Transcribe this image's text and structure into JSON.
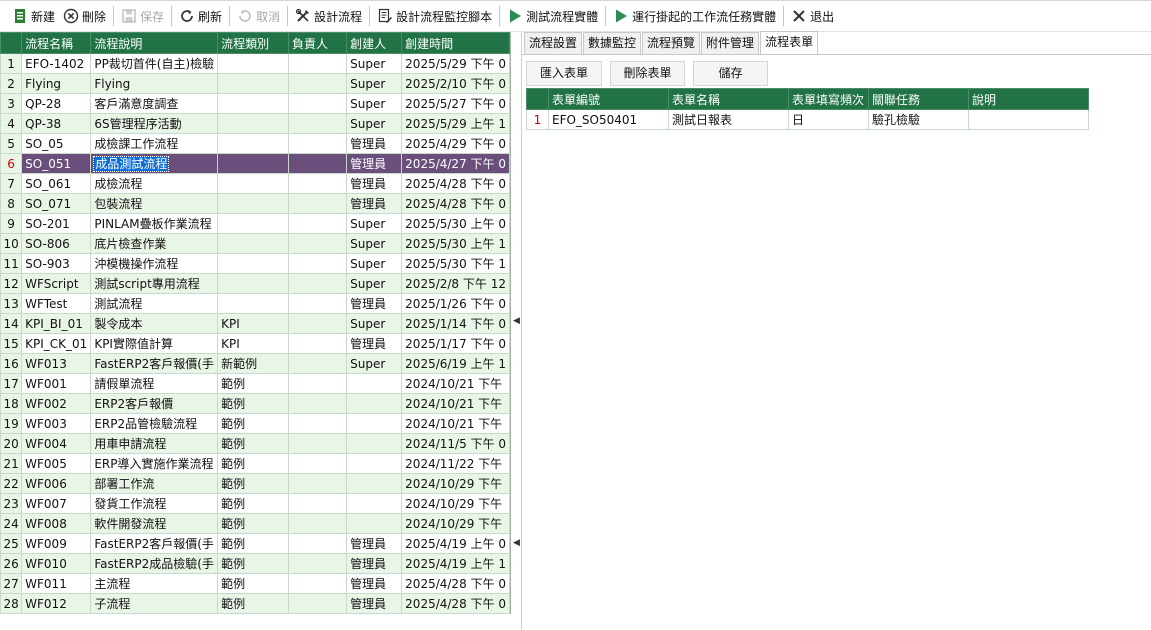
{
  "toolbar": {
    "new": "新建",
    "delete": "刪除",
    "save": "保存",
    "refresh": "刷新",
    "cancel": "取消",
    "design": "設計流程",
    "monitor_script": "設計流程監控腳本",
    "test_instance": "測試流程實體",
    "pending": "運行掛起的工作流任務實體",
    "exit": "退出"
  },
  "left_grid": {
    "headers": [
      "流程名稱",
      "流程說明",
      "流程類別",
      "負責人",
      "創建人",
      "創建時間"
    ],
    "selected_row_index": 5,
    "rows": [
      {
        "n": "1",
        "name": "EFO-1402",
        "desc": "PP裁切首件(自主)檢驗",
        "cat": "",
        "owner": "",
        "creator": "Super",
        "time": "2025/5/29 下午 0"
      },
      {
        "n": "2",
        "name": "Flying",
        "desc": "Flying",
        "cat": "",
        "owner": "",
        "creator": "Super",
        "time": "2025/2/10 下午 0"
      },
      {
        "n": "3",
        "name": "QP-28",
        "desc": "客戶滿意度調查",
        "cat": "",
        "owner": "",
        "creator": "Super",
        "time": "2025/5/27 下午 0"
      },
      {
        "n": "4",
        "name": "QP-38",
        "desc": "6S管理程序活動",
        "cat": "",
        "owner": "",
        "creator": "Super",
        "time": "2025/5/29 上午 1"
      },
      {
        "n": "5",
        "name": "SO_05",
        "desc": "成檢課工作流程",
        "cat": "",
        "owner": "",
        "creator": "管理員",
        "time": "2025/4/29 下午 0"
      },
      {
        "n": "6",
        "name": "SO_051",
        "desc": "成品測試流程",
        "cat": "",
        "owner": "",
        "creator": "管理員",
        "time": "2025/4/27 下午 0"
      },
      {
        "n": "7",
        "name": "SO_061",
        "desc": "成檢流程",
        "cat": "",
        "owner": "",
        "creator": "管理員",
        "time": "2025/4/28 下午 0"
      },
      {
        "n": "8",
        "name": "SO_071",
        "desc": "包裝流程",
        "cat": "",
        "owner": "",
        "creator": "管理員",
        "time": "2025/4/28 下午 0"
      },
      {
        "n": "9",
        "name": "SO-201",
        "desc": "PINLAM疊板作業流程",
        "cat": "",
        "owner": "",
        "creator": "Super",
        "time": "2025/5/30 上午 0"
      },
      {
        "n": "10",
        "name": "SO-806",
        "desc": "底片檢查作業",
        "cat": "",
        "owner": "",
        "creator": "Super",
        "time": "2025/5/30 上午 1"
      },
      {
        "n": "11",
        "name": "SO-903",
        "desc": "沖模機操作流程",
        "cat": "",
        "owner": "",
        "creator": "Super",
        "time": "2025/5/30 下午 1"
      },
      {
        "n": "12",
        "name": "WFScript",
        "desc": "測試script專用流程",
        "cat": "",
        "owner": "",
        "creator": "Super",
        "time": "2025/2/8 下午 12"
      },
      {
        "n": "13",
        "name": "WFTest",
        "desc": "測試流程",
        "cat": "",
        "owner": "",
        "creator": "管理員",
        "time": "2025/1/26 下午 0"
      },
      {
        "n": "14",
        "name": "KPI_BI_01",
        "desc": "製令成本",
        "cat": "KPI",
        "owner": "",
        "creator": "Super",
        "time": "2025/1/14 下午 0"
      },
      {
        "n": "15",
        "name": "KPI_CK_01",
        "desc": "KPI實際值計算",
        "cat": "KPI",
        "owner": "",
        "creator": "管理員",
        "time": "2025/1/17 下午 0"
      },
      {
        "n": "16",
        "name": "WF013",
        "desc": "FastERP2客戶報價(手",
        "cat": "新範例",
        "owner": "",
        "creator": "Super",
        "time": "2025/6/19 上午 1"
      },
      {
        "n": "17",
        "name": "WF001",
        "desc": "請假單流程",
        "cat": "範例",
        "owner": "",
        "creator": "",
        "time": "2024/10/21 下午"
      },
      {
        "n": "18",
        "name": "WF002",
        "desc": "ERP2客戶報價",
        "cat": "範例",
        "owner": "",
        "creator": "",
        "time": "2024/10/21 下午"
      },
      {
        "n": "19",
        "name": "WF003",
        "desc": "ERP2品管檢驗流程",
        "cat": "範例",
        "owner": "",
        "creator": "",
        "time": "2024/10/21 下午"
      },
      {
        "n": "20",
        "name": "WF004",
        "desc": "用車申請流程",
        "cat": "範例",
        "owner": "",
        "creator": "",
        "time": "2024/11/5 下午 0"
      },
      {
        "n": "21",
        "name": "WF005",
        "desc": "ERP導入實施作業流程",
        "cat": "範例",
        "owner": "",
        "creator": "",
        "time": "2024/11/22 下午"
      },
      {
        "n": "22",
        "name": "WF006",
        "desc": "部署工作流",
        "cat": "範例",
        "owner": "",
        "creator": "",
        "time": "2024/10/29 下午"
      },
      {
        "n": "23",
        "name": "WF007",
        "desc": "發貨工作流程",
        "cat": "範例",
        "owner": "",
        "creator": "",
        "time": "2024/10/29 下午"
      },
      {
        "n": "24",
        "name": "WF008",
        "desc": "軟件開發流程",
        "cat": "範例",
        "owner": "",
        "creator": "",
        "time": "2024/10/29 下午"
      },
      {
        "n": "25",
        "name": "WF009",
        "desc": "FastERP2客戶報價(手",
        "cat": "範例",
        "owner": "",
        "creator": "管理員",
        "time": "2025/4/19 上午 0"
      },
      {
        "n": "26",
        "name": "WF010",
        "desc": "FastERP2成品檢驗(手",
        "cat": "範例",
        "owner": "",
        "creator": "管理員",
        "time": "2025/4/19 上午 1"
      },
      {
        "n": "27",
        "name": "WF011",
        "desc": "主流程",
        "cat": "範例",
        "owner": "",
        "creator": "管理員",
        "time": "2025/4/28 下午 0"
      },
      {
        "n": "28",
        "name": "WF012",
        "desc": "子流程",
        "cat": "範例",
        "owner": "",
        "creator": "管理員",
        "time": "2025/4/28 下午 0"
      }
    ]
  },
  "right_tabs": [
    "流程設置",
    "數據監控",
    "流程預覽",
    "附件管理",
    "流程表單"
  ],
  "right_active_tab": 4,
  "form_buttons": {
    "import": "匯入表單",
    "delete": "刪除表單",
    "save": "儲存"
  },
  "form_grid": {
    "headers": [
      "表單編號",
      "表單名稱",
      "表單填寫頻次",
      "關聯任務",
      "說明"
    ],
    "rows": [
      {
        "n": "1",
        "id": "EFO_SO50401",
        "name": "測試日報表",
        "freq": "日",
        "task": "驗孔檢驗",
        "note": ""
      }
    ]
  },
  "colors": {
    "header_green": "#217346",
    "row_alt": "#e9f5e6",
    "selected_row": "#6a4f7c",
    "selected_cell": "#0d6ed6"
  }
}
